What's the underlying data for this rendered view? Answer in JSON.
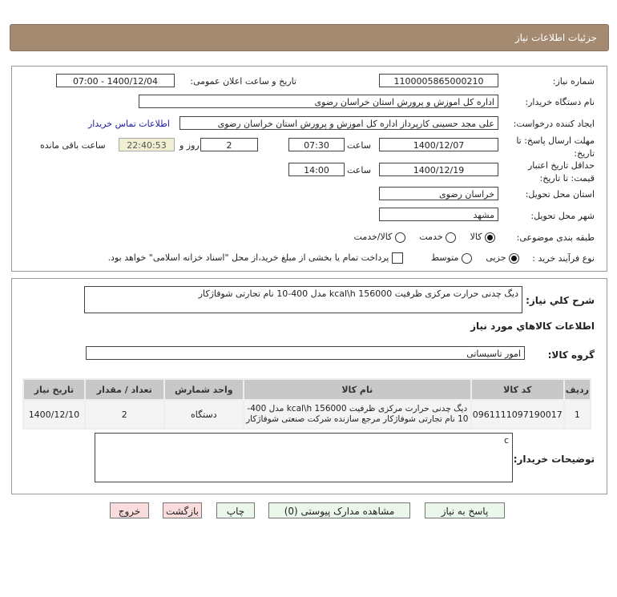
{
  "header": {
    "title": "جزئیات اطلاعات نیاز"
  },
  "form": {
    "need_number_label": "شماره نیاز:",
    "need_number": "1100005865000210",
    "announce_label": "تاریخ و ساعت اعلان عمومی:",
    "announce_value": "1400/12/04 - 07:00",
    "buyer_org_label": "نام دستگاه خریدار:",
    "buyer_org": "اداره کل اموزش و پرورش استان خراسان رضوی",
    "creator_label": "ایجاد کننده درخواست:",
    "creator": "علی مجد حسینی کارپرداز اداره کل اموزش و پرورش استان خراسان رضوی",
    "contact_link": "اطلاعات تماس خریدار",
    "deadline_label": "مهلت ارسال پاسخ: تا تاریخ:",
    "deadline_date": "1400/12/07",
    "time_label": "ساعت",
    "deadline_time": "07:30",
    "days": "2",
    "days_label": "روز و",
    "remaining": "22:40:53",
    "remaining_label": "ساعت باقی مانده",
    "validity_label": "حداقل تاریخ اعتبار قیمت: تا تاریخ:",
    "validity_date": "1400/12/19",
    "validity_time": "14:00",
    "province_label": "استان محل تحویل:",
    "province": "خراسان رضوی",
    "city_label": "شهر محل تحویل:",
    "city": "مشهد",
    "category_label": "طبقه بندی موضوعی:",
    "category_options": [
      "کالا",
      "خدمت",
      "کالا/خدمت"
    ],
    "category_selected": "کالا",
    "process_label": "نوع فرآیند خرید :",
    "process_options": [
      "جزیی",
      "متوسط"
    ],
    "process_selected": "جزیی",
    "payment_note": "پرداخت تمام یا بخشی از مبلغ خرید،از محل \"اسناد خزانه اسلامی\" خواهد بود."
  },
  "details": {
    "summary_label": "شرح کلي نياز:",
    "summary": "دیگ چدنی حرارت مرکزی ظرفیت kcal\\h 156000 مدل 400-10 نام تجارتی شوفاژکار",
    "goods_title": "اطلاعات کالاهاي مورد نياز",
    "group_label": "گروه کالا:",
    "group": "امور تاسیساتی",
    "table": {
      "headers": [
        "ردیف",
        "کد کالا",
        "نام کالا",
        "واحد شمارش",
        "تعداد / مقدار",
        "تاریخ نیاز"
      ],
      "rows": [
        [
          "1",
          "0961111097190017",
          "دیگ چدنی حرارت مرکزی ظرفیت kcal\\h 156000 مدل 400-10 نام تجارتی شوفاژکار مرجع سازنده شرکت صنعتی شوفاژکار",
          "دستگاه",
          "2",
          "1400/12/10"
        ]
      ]
    },
    "notes_label": "توضیحات خریدار:",
    "notes": "c"
  },
  "buttons": {
    "reply": "پاسخ به نیاز",
    "docs": "مشاهده مدارک پیوستی (0)",
    "print": "چاپ",
    "back": "بازگشت",
    "exit": "خروج"
  },
  "colors": {
    "header": "#a58a72",
    "link": "#1a1aa6",
    "remaining_bg": "#f1efd2"
  }
}
